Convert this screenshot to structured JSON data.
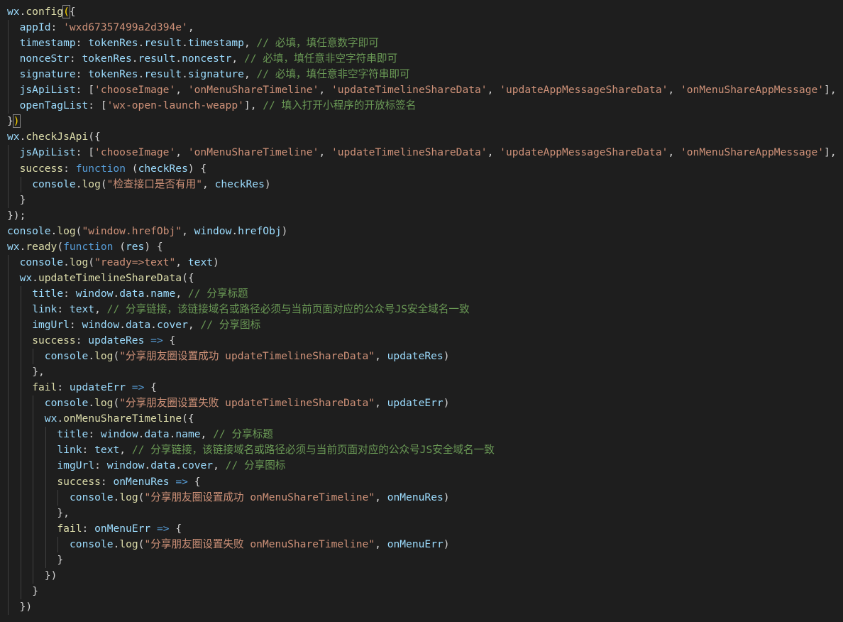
{
  "editor": {
    "theme": {
      "background": "#1e1e1e",
      "function": "#dcdcaa",
      "variable": "#9cdcfe",
      "string": "#ce9178",
      "keyword": "#569cd6",
      "comment": "#6a9955",
      "punctuation": "#d4d4d4"
    },
    "lines": [
      {
        "indent": 0,
        "tokens": [
          {
            "t": "wx",
            "c": "var"
          },
          {
            "t": ".",
            "c": "p"
          },
          {
            "t": "config",
            "c": "fn"
          },
          {
            "t": "(",
            "c": "br"
          },
          {
            "t": "{",
            "c": "p"
          }
        ]
      },
      {
        "indent": 1,
        "tokens": [
          {
            "t": "appId",
            "c": "var"
          },
          {
            "t": ": ",
            "c": "p"
          },
          {
            "t": "'wxd67357499a2d394e'",
            "c": "str"
          },
          {
            "t": ",",
            "c": "p"
          }
        ]
      },
      {
        "indent": 1,
        "tokens": [
          {
            "t": "timestamp",
            "c": "var"
          },
          {
            "t": ": ",
            "c": "p"
          },
          {
            "t": "tokenRes",
            "c": "var"
          },
          {
            "t": ".",
            "c": "p"
          },
          {
            "t": "result",
            "c": "var"
          },
          {
            "t": ".",
            "c": "p"
          },
          {
            "t": "timestamp",
            "c": "var"
          },
          {
            "t": ", ",
            "c": "p"
          },
          {
            "t": "// 必填，填任意数字即可",
            "c": "cm"
          }
        ]
      },
      {
        "indent": 1,
        "tokens": [
          {
            "t": "nonceStr",
            "c": "var"
          },
          {
            "t": ": ",
            "c": "p"
          },
          {
            "t": "tokenRes",
            "c": "var"
          },
          {
            "t": ".",
            "c": "p"
          },
          {
            "t": "result",
            "c": "var"
          },
          {
            "t": ".",
            "c": "p"
          },
          {
            "t": "noncestr",
            "c": "var"
          },
          {
            "t": ", ",
            "c": "p"
          },
          {
            "t": "// 必填，填任意非空字符串即可",
            "c": "cm"
          }
        ]
      },
      {
        "indent": 1,
        "tokens": [
          {
            "t": "signature",
            "c": "var"
          },
          {
            "t": ": ",
            "c": "p"
          },
          {
            "t": "tokenRes",
            "c": "var"
          },
          {
            "t": ".",
            "c": "p"
          },
          {
            "t": "result",
            "c": "var"
          },
          {
            "t": ".",
            "c": "p"
          },
          {
            "t": "signature",
            "c": "var"
          },
          {
            "t": ", ",
            "c": "p"
          },
          {
            "t": "// 必填，填任意非空字符串即可",
            "c": "cm"
          }
        ]
      },
      {
        "indent": 1,
        "tokens": [
          {
            "t": "jsApiList",
            "c": "var"
          },
          {
            "t": ": [",
            "c": "p"
          },
          {
            "t": "'chooseImage'",
            "c": "str"
          },
          {
            "t": ", ",
            "c": "p"
          },
          {
            "t": "'onMenuShareTimeline'",
            "c": "str"
          },
          {
            "t": ", ",
            "c": "p"
          },
          {
            "t": "'updateTimelineShareData'",
            "c": "str"
          },
          {
            "t": ", ",
            "c": "p"
          },
          {
            "t": "'updateAppMessageShareData'",
            "c": "str"
          },
          {
            "t": ", ",
            "c": "p"
          },
          {
            "t": "'onMenuShareAppMessage'",
            "c": "str"
          },
          {
            "t": "],",
            "c": "p"
          }
        ]
      },
      {
        "indent": 1,
        "tokens": [
          {
            "t": "openTagList",
            "c": "var"
          },
          {
            "t": ": [",
            "c": "p"
          },
          {
            "t": "'wx-open-launch-weapp'",
            "c": "str"
          },
          {
            "t": "], ",
            "c": "p"
          },
          {
            "t": "// 填入打开小程序的开放标签名",
            "c": "cm"
          }
        ]
      },
      {
        "indent": 0,
        "tokens": [
          {
            "t": "}",
            "c": "p"
          },
          {
            "t": ")",
            "c": "br"
          }
        ]
      },
      {
        "indent": 0,
        "tokens": [
          {
            "t": "wx",
            "c": "var"
          },
          {
            "t": ".",
            "c": "p"
          },
          {
            "t": "checkJsApi",
            "c": "fn"
          },
          {
            "t": "({",
            "c": "p"
          }
        ]
      },
      {
        "indent": 1,
        "tokens": [
          {
            "t": "jsApiList",
            "c": "var"
          },
          {
            "t": ": [",
            "c": "p"
          },
          {
            "t": "'chooseImage'",
            "c": "str"
          },
          {
            "t": ", ",
            "c": "p"
          },
          {
            "t": "'onMenuShareTimeline'",
            "c": "str"
          },
          {
            "t": ", ",
            "c": "p"
          },
          {
            "t": "'updateTimelineShareData'",
            "c": "str"
          },
          {
            "t": ", ",
            "c": "p"
          },
          {
            "t": "'updateAppMessageShareData'",
            "c": "str"
          },
          {
            "t": ", ",
            "c": "p"
          },
          {
            "t": "'onMenuShareAppMessage'",
            "c": "str"
          },
          {
            "t": "],",
            "c": "p"
          }
        ]
      },
      {
        "indent": 1,
        "tokens": [
          {
            "t": "success",
            "c": "fn"
          },
          {
            "t": ": ",
            "c": "p"
          },
          {
            "t": "function",
            "c": "kw"
          },
          {
            "t": " (",
            "c": "p"
          },
          {
            "t": "checkRes",
            "c": "var"
          },
          {
            "t": ") {",
            "c": "p"
          }
        ]
      },
      {
        "indent": 2,
        "tokens": [
          {
            "t": "console",
            "c": "var"
          },
          {
            "t": ".",
            "c": "p"
          },
          {
            "t": "log",
            "c": "fn"
          },
          {
            "t": "(",
            "c": "p"
          },
          {
            "t": "\"检查接口是否有用\"",
            "c": "str"
          },
          {
            "t": ", ",
            "c": "p"
          },
          {
            "t": "checkRes",
            "c": "var"
          },
          {
            "t": ")",
            "c": "p"
          }
        ]
      },
      {
        "indent": 1,
        "tokens": [
          {
            "t": "}",
            "c": "p"
          }
        ]
      },
      {
        "indent": 0,
        "tokens": [
          {
            "t": "});",
            "c": "p"
          }
        ]
      },
      {
        "indent": 0,
        "tokens": [
          {
            "t": "console",
            "c": "var"
          },
          {
            "t": ".",
            "c": "p"
          },
          {
            "t": "log",
            "c": "fn"
          },
          {
            "t": "(",
            "c": "p"
          },
          {
            "t": "\"window.hrefObj\"",
            "c": "str"
          },
          {
            "t": ", ",
            "c": "p"
          },
          {
            "t": "window",
            "c": "var"
          },
          {
            "t": ".",
            "c": "p"
          },
          {
            "t": "hrefObj",
            "c": "var"
          },
          {
            "t": ")",
            "c": "p"
          }
        ]
      },
      {
        "indent": 0,
        "tokens": [
          {
            "t": "wx",
            "c": "var"
          },
          {
            "t": ".",
            "c": "p"
          },
          {
            "t": "ready",
            "c": "fn"
          },
          {
            "t": "(",
            "c": "p"
          },
          {
            "t": "function",
            "c": "kw"
          },
          {
            "t": " (",
            "c": "p"
          },
          {
            "t": "res",
            "c": "var"
          },
          {
            "t": ") {",
            "c": "p"
          }
        ]
      },
      {
        "indent": 1,
        "tokens": [
          {
            "t": "console",
            "c": "var"
          },
          {
            "t": ".",
            "c": "p"
          },
          {
            "t": "log",
            "c": "fn"
          },
          {
            "t": "(",
            "c": "p"
          },
          {
            "t": "\"ready=>text\"",
            "c": "str"
          },
          {
            "t": ", ",
            "c": "p"
          },
          {
            "t": "text",
            "c": "var"
          },
          {
            "t": ")",
            "c": "p"
          }
        ]
      },
      {
        "indent": 1,
        "tokens": [
          {
            "t": "wx",
            "c": "var"
          },
          {
            "t": ".",
            "c": "p"
          },
          {
            "t": "updateTimelineShareData",
            "c": "fn"
          },
          {
            "t": "({",
            "c": "p"
          }
        ]
      },
      {
        "indent": 2,
        "tokens": [
          {
            "t": "title",
            "c": "var"
          },
          {
            "t": ": ",
            "c": "p"
          },
          {
            "t": "window",
            "c": "var"
          },
          {
            "t": ".",
            "c": "p"
          },
          {
            "t": "data",
            "c": "var"
          },
          {
            "t": ".",
            "c": "p"
          },
          {
            "t": "name",
            "c": "var"
          },
          {
            "t": ", ",
            "c": "p"
          },
          {
            "t": "// 分享标题",
            "c": "cm"
          }
        ]
      },
      {
        "indent": 2,
        "tokens": [
          {
            "t": "link",
            "c": "var"
          },
          {
            "t": ": ",
            "c": "p"
          },
          {
            "t": "text",
            "c": "var"
          },
          {
            "t": ", ",
            "c": "p"
          },
          {
            "t": "// 分享链接，该链接域名或路径必须与当前页面对应的公众号JS安全域名一致",
            "c": "cm"
          }
        ]
      },
      {
        "indent": 2,
        "tokens": [
          {
            "t": "imgUrl",
            "c": "var"
          },
          {
            "t": ": ",
            "c": "p"
          },
          {
            "t": "window",
            "c": "var"
          },
          {
            "t": ".",
            "c": "p"
          },
          {
            "t": "data",
            "c": "var"
          },
          {
            "t": ".",
            "c": "p"
          },
          {
            "t": "cover",
            "c": "var"
          },
          {
            "t": ", ",
            "c": "p"
          },
          {
            "t": "// 分享图标",
            "c": "cm"
          }
        ]
      },
      {
        "indent": 2,
        "tokens": [
          {
            "t": "success",
            "c": "fn"
          },
          {
            "t": ": ",
            "c": "p"
          },
          {
            "t": "updateRes",
            "c": "var"
          },
          {
            "t": " ",
            "c": "p"
          },
          {
            "t": "=>",
            "c": "kw"
          },
          {
            "t": " {",
            "c": "p"
          }
        ]
      },
      {
        "indent": 3,
        "tokens": [
          {
            "t": "console",
            "c": "var"
          },
          {
            "t": ".",
            "c": "p"
          },
          {
            "t": "log",
            "c": "fn"
          },
          {
            "t": "(",
            "c": "p"
          },
          {
            "t": "\"分享朋友圈设置成功 updateTimelineShareData\"",
            "c": "str"
          },
          {
            "t": ", ",
            "c": "p"
          },
          {
            "t": "updateRes",
            "c": "var"
          },
          {
            "t": ")",
            "c": "p"
          }
        ]
      },
      {
        "indent": 2,
        "tokens": [
          {
            "t": "},",
            "c": "p"
          }
        ]
      },
      {
        "indent": 2,
        "tokens": [
          {
            "t": "fail",
            "c": "fn"
          },
          {
            "t": ": ",
            "c": "p"
          },
          {
            "t": "updateErr",
            "c": "var"
          },
          {
            "t": " ",
            "c": "p"
          },
          {
            "t": "=>",
            "c": "kw"
          },
          {
            "t": " {",
            "c": "p"
          }
        ]
      },
      {
        "indent": 3,
        "tokens": [
          {
            "t": "console",
            "c": "var"
          },
          {
            "t": ".",
            "c": "p"
          },
          {
            "t": "log",
            "c": "fn"
          },
          {
            "t": "(",
            "c": "p"
          },
          {
            "t": "\"分享朋友圈设置失败 updateTimelineShareData\"",
            "c": "str"
          },
          {
            "t": ", ",
            "c": "p"
          },
          {
            "t": "updateErr",
            "c": "var"
          },
          {
            "t": ")",
            "c": "p"
          }
        ]
      },
      {
        "indent": 3,
        "tokens": [
          {
            "t": "wx",
            "c": "var"
          },
          {
            "t": ".",
            "c": "p"
          },
          {
            "t": "onMenuShareTimeline",
            "c": "fn"
          },
          {
            "t": "({",
            "c": "p"
          }
        ]
      },
      {
        "indent": 4,
        "tokens": [
          {
            "t": "title",
            "c": "var"
          },
          {
            "t": ": ",
            "c": "p"
          },
          {
            "t": "window",
            "c": "var"
          },
          {
            "t": ".",
            "c": "p"
          },
          {
            "t": "data",
            "c": "var"
          },
          {
            "t": ".",
            "c": "p"
          },
          {
            "t": "name",
            "c": "var"
          },
          {
            "t": ", ",
            "c": "p"
          },
          {
            "t": "// 分享标题",
            "c": "cm"
          }
        ]
      },
      {
        "indent": 4,
        "tokens": [
          {
            "t": "link",
            "c": "var"
          },
          {
            "t": ": ",
            "c": "p"
          },
          {
            "t": "text",
            "c": "var"
          },
          {
            "t": ", ",
            "c": "p"
          },
          {
            "t": "// 分享链接，该链接域名或路径必须与当前页面对应的公众号JS安全域名一致",
            "c": "cm"
          }
        ]
      },
      {
        "indent": 4,
        "tokens": [
          {
            "t": "imgUrl",
            "c": "var"
          },
          {
            "t": ": ",
            "c": "p"
          },
          {
            "t": "window",
            "c": "var"
          },
          {
            "t": ".",
            "c": "p"
          },
          {
            "t": "data",
            "c": "var"
          },
          {
            "t": ".",
            "c": "p"
          },
          {
            "t": "cover",
            "c": "var"
          },
          {
            "t": ", ",
            "c": "p"
          },
          {
            "t": "// 分享图标",
            "c": "cm"
          }
        ]
      },
      {
        "indent": 4,
        "tokens": [
          {
            "t": "success",
            "c": "fn"
          },
          {
            "t": ": ",
            "c": "p"
          },
          {
            "t": "onMenuRes",
            "c": "var"
          },
          {
            "t": " ",
            "c": "p"
          },
          {
            "t": "=>",
            "c": "kw"
          },
          {
            "t": " {",
            "c": "p"
          }
        ]
      },
      {
        "indent": 5,
        "tokens": [
          {
            "t": "console",
            "c": "var"
          },
          {
            "t": ".",
            "c": "p"
          },
          {
            "t": "log",
            "c": "fn"
          },
          {
            "t": "(",
            "c": "p"
          },
          {
            "t": "\"分享朋友圈设置成功 onMenuShareTimeline\"",
            "c": "str"
          },
          {
            "t": ", ",
            "c": "p"
          },
          {
            "t": "onMenuRes",
            "c": "var"
          },
          {
            "t": ")",
            "c": "p"
          }
        ]
      },
      {
        "indent": 4,
        "tokens": [
          {
            "t": "},",
            "c": "p"
          }
        ]
      },
      {
        "indent": 4,
        "tokens": [
          {
            "t": "fail",
            "c": "fn"
          },
          {
            "t": ": ",
            "c": "p"
          },
          {
            "t": "onMenuErr",
            "c": "var"
          },
          {
            "t": " ",
            "c": "p"
          },
          {
            "t": "=>",
            "c": "kw"
          },
          {
            "t": " {",
            "c": "p"
          }
        ]
      },
      {
        "indent": 5,
        "tokens": [
          {
            "t": "console",
            "c": "var"
          },
          {
            "t": ".",
            "c": "p"
          },
          {
            "t": "log",
            "c": "fn"
          },
          {
            "t": "(",
            "c": "p"
          },
          {
            "t": "\"分享朋友圈设置失败 onMenuShareTimeline\"",
            "c": "str"
          },
          {
            "t": ", ",
            "c": "p"
          },
          {
            "t": "onMenuErr",
            "c": "var"
          },
          {
            "t": ")",
            "c": "p"
          }
        ]
      },
      {
        "indent": 4,
        "tokens": [
          {
            "t": "}",
            "c": "p"
          }
        ]
      },
      {
        "indent": 3,
        "tokens": [
          {
            "t": "})",
            "c": "p"
          }
        ]
      },
      {
        "indent": 2,
        "tokens": [
          {
            "t": "}",
            "c": "p"
          }
        ]
      },
      {
        "indent": 1,
        "tokens": [
          {
            "t": "})",
            "c": "p"
          }
        ]
      }
    ]
  }
}
